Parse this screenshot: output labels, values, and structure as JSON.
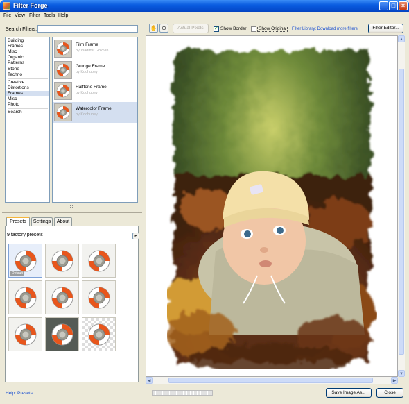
{
  "window": {
    "title": "Filter Forge",
    "controls": {
      "minimize": "_",
      "maximize": "□",
      "close": "×"
    }
  },
  "menu": [
    "File",
    "View",
    "Filter",
    "Tools",
    "Help"
  ],
  "left": {
    "search_label": "Search Filters:",
    "search_value": "",
    "categories_group1": [
      "Building",
      "Frames",
      "Misc",
      "Organic",
      "Patterns",
      "Stone",
      "Techno"
    ],
    "categories_group2": [
      "Creative",
      "Distortions",
      "Frames",
      "Misc",
      "Photo"
    ],
    "categories_group3": [
      "Search"
    ],
    "selected_category": "Frames",
    "filters": [
      {
        "name": "Film Frame",
        "author": "by Vladimir Golovin"
      },
      {
        "name": "Grunge Frame",
        "author": "by Kochubey"
      },
      {
        "name": "Halftone Frame",
        "author": "by Kochubey"
      },
      {
        "name": "Watercolor Frame",
        "author": "by Kochubey"
      }
    ],
    "selected_filter": "Watercolor Frame",
    "tabs": [
      "Presets",
      "Settings",
      "About"
    ],
    "active_tab": "Presets",
    "presets_count": "9 factory presets",
    "presets_nav": "▸",
    "default_badge": "Default",
    "help_link": "Help: Presets"
  },
  "toolbar": {
    "hand_icon": "✋",
    "zoom_icon": "⊕",
    "actual_pixels": "Actual Pixels",
    "show_border": "Show Border",
    "show_border_checked": true,
    "show_original": "Show Original",
    "show_original_checked": false,
    "library_link": "Filter Library: Download more filters",
    "filter_editor": "Filter Editor..."
  },
  "bottom": {
    "save_image": "Save Image As...",
    "close": "Close"
  },
  "scroll": {
    "up": "▲",
    "down": "▼",
    "left": "◀",
    "right": "▶"
  },
  "colors": {
    "accent_link": "#1a4fd0",
    "title_bar": "#0a5ce0",
    "selection": "#d4dff0",
    "ring_orange": "#e8561c"
  }
}
